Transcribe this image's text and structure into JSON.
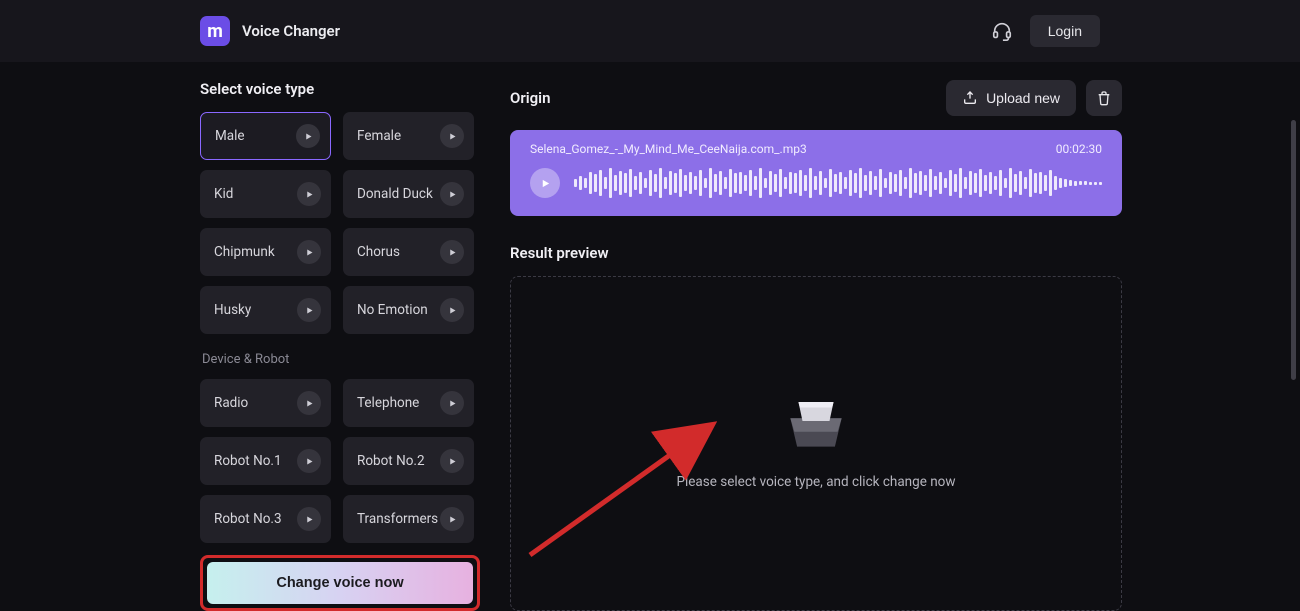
{
  "header": {
    "app_title": "Voice Changer",
    "login_label": "Login"
  },
  "sidebar": {
    "title": "Select voice type",
    "group_device": "Device & Robot",
    "voices_a": [
      {
        "label": "Male",
        "selected": true
      },
      {
        "label": "Female"
      },
      {
        "label": "Kid"
      },
      {
        "label": "Donald Duck"
      },
      {
        "label": "Chipmunk"
      },
      {
        "label": "Chorus"
      },
      {
        "label": "Husky"
      },
      {
        "label": "No Emotion"
      }
    ],
    "voices_b": [
      {
        "label": "Radio"
      },
      {
        "label": "Telephone"
      },
      {
        "label": "Robot No.1"
      },
      {
        "label": "Robot No.2"
      },
      {
        "label": "Robot No.3"
      },
      {
        "label": "Transformers"
      }
    ],
    "cta_label": "Change voice now"
  },
  "origin": {
    "title": "Origin",
    "upload_label": "Upload new",
    "file_name": "Selena_Gomez_-_My_Mind_Me_CeeNaija.com_.mp3",
    "duration": "00:02:30"
  },
  "result": {
    "title": "Result preview",
    "help_text": "Please select voice type, and click change now"
  }
}
